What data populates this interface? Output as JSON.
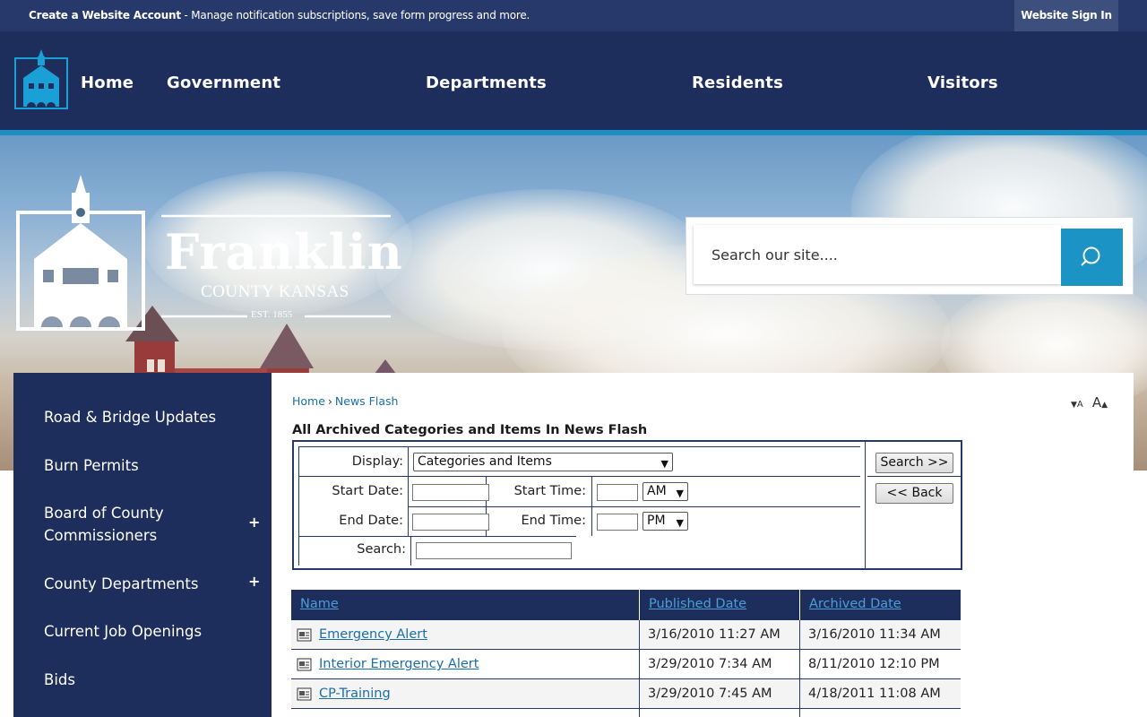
{
  "topbar": {
    "account_link": "Create a Website Account",
    "account_msg": " - Manage notification subscriptions, save form progress and more.",
    "signin": "Website Sign In"
  },
  "nav": {
    "items": [
      "Home",
      "Government",
      "Departments",
      "Residents",
      "Visitors"
    ]
  },
  "brand": {
    "name": "Franklin",
    "subtitle": "COUNTY KANSAS",
    "est": "EST. 1855"
  },
  "search": {
    "placeholder": "Search our site...."
  },
  "sidebar": {
    "items": [
      {
        "label": "Road & Bridge Updates",
        "expandable": false
      },
      {
        "label": "Burn Permits",
        "expandable": false
      },
      {
        "label": "Board of County Commissioners",
        "expandable": true
      },
      {
        "label": "County Departments",
        "expandable": true
      },
      {
        "label": "Current Job Openings",
        "expandable": false
      },
      {
        "label": "Bids",
        "expandable": false
      }
    ],
    "expand_glyph": "+"
  },
  "breadcrumb": {
    "home": "Home",
    "separator": "›",
    "current": "News Flash"
  },
  "textsize": {
    "decrease": "A",
    "increase": "A"
  },
  "page": {
    "heading": "All Archived Categories and Items In News Flash"
  },
  "form": {
    "display_label": "Display:",
    "display_value": "Categories and Items",
    "start_date_label": "Start Date:",
    "start_time_label": "Start Time:",
    "start_ampm": "AM",
    "end_date_label": "End Date:",
    "end_time_label": "End Time:",
    "end_ampm": "PM",
    "search_label": "Search:",
    "search_button": "Search >>",
    "back_button": "<< Back"
  },
  "table": {
    "headers": [
      "Name",
      "Published Date",
      "Archived Date"
    ],
    "rows": [
      {
        "name": "Emergency Alert",
        "published": "3/16/2010 11:27 AM",
        "archived": "3/16/2010 11:34 AM"
      },
      {
        "name": "Interior Emergency Alert",
        "published": "3/29/2010 7:34 AM",
        "archived": "8/11/2010 12:10 PM"
      },
      {
        "name": "CP-Training",
        "published": "3/29/2010 7:45 AM",
        "archived": "4/18/2011 11:08 AM"
      }
    ]
  },
  "colors": {
    "topbar": "#27396b",
    "nav": "#1e2e5c",
    "accent": "#1a8fc2",
    "link": "#1a6fa8"
  },
  "icons": {
    "search_button": "search-icon",
    "nav_logo": "courthouse-logo-icon",
    "row_icon": "news-item-icon"
  }
}
